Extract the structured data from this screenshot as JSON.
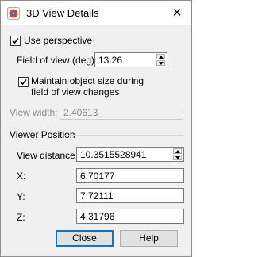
{
  "window": {
    "title": "3D View Details",
    "app_icon": "tecplot-app-icon",
    "close_glyph": "✕"
  },
  "perspective": {
    "label": "Use perspective",
    "checked": true
  },
  "field_of_view": {
    "label": "Field of view (deg):",
    "value": "13.26"
  },
  "maintain_size": {
    "label_line1": "Maintain object size during",
    "label_line2": "field of view changes",
    "checked": true
  },
  "view_width": {
    "label": "View width:",
    "value": "2.40613",
    "enabled": false
  },
  "viewer_position": {
    "group_label": "Viewer Position",
    "view_distance": {
      "label": "View distance:",
      "value": "10.3515528941"
    },
    "x": {
      "label": "X:",
      "value": "6.70177"
    },
    "y": {
      "label": "Y:",
      "value": "7.72111"
    },
    "z": {
      "label": "Z:",
      "value": "4.31796"
    }
  },
  "buttons": {
    "close_label": "Close",
    "help_label": "Help"
  },
  "colors": {
    "dialog_bg": "#f0f0f0",
    "accent": "#0078d7"
  }
}
